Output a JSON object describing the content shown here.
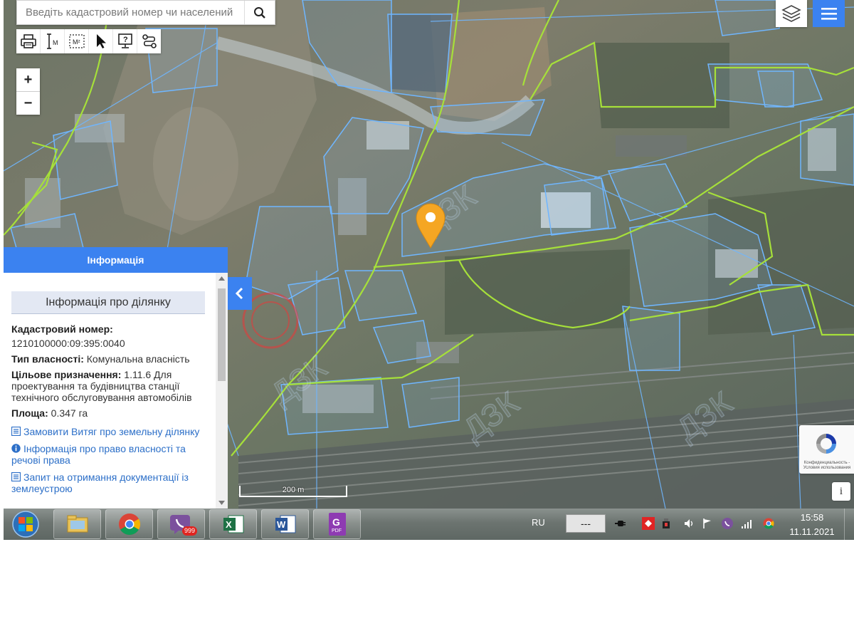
{
  "search": {
    "placeholder": "Введіть кадастровий номер чи населений"
  },
  "map": {
    "scale_label": "200 m"
  },
  "info_panel": {
    "header": "Інформація",
    "subtitle": "Інформація про ділянку",
    "cadastral_label": "Кадастровий номер:",
    "cadastral_number": "1210100000:09:395:0040",
    "ownership_label": "Тип власності:",
    "ownership_value": "Комунальна власність",
    "purpose_label": "Цільове призначення:",
    "purpose_value": "1.11.6 Для проектування та будівництва станції технічного обслуговування автомобілів",
    "area_label": "Площа:",
    "area_value": "0.347 га",
    "links": [
      "Замовити Витяг про земельну ділянку",
      "Інформація про право власності та речові права",
      "Запит на отримання документації із землеустрою"
    ]
  },
  "recaptcha": {
    "text": "Конфиденциальность - Условия использования"
  },
  "info_button": "i",
  "taskbar": {
    "apps": [
      "windows-explorer",
      "chrome",
      "viber",
      "excel",
      "word",
      "pdf-editor"
    ],
    "viber_badge": "999",
    "pdf_label": "PDF",
    "lang": "RU",
    "tray_field": "---",
    "time": "15:58",
    "date": "11.11.2021"
  },
  "colors": {
    "accent": "#3b82f0",
    "marker": "#f5a623",
    "parcel_outline": "#6fb6ff",
    "boundary_green": "#a6e03a"
  }
}
